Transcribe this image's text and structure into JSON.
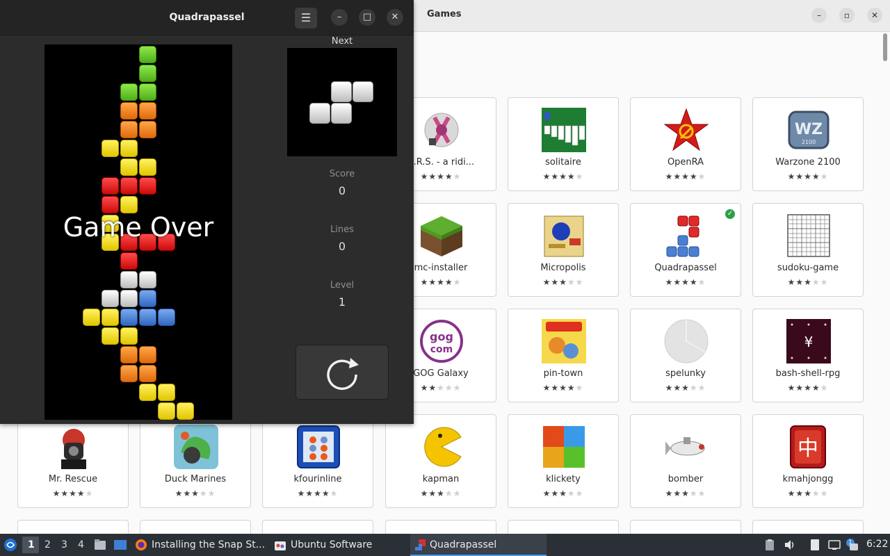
{
  "games_window": {
    "title": "Games",
    "controls": {
      "minimize": "–",
      "maximize": "▫",
      "close": "✕"
    },
    "tiles": [
      {
        "name": "A.R.S. - a ridi...",
        "rating": 4,
        "icon": "ars-icon",
        "installed": false
      },
      {
        "name": "solitaire",
        "rating": 4,
        "icon": "solitaire-icon",
        "installed": false
      },
      {
        "name": "OpenRA",
        "rating": 4,
        "icon": "openra-icon",
        "installed": false
      },
      {
        "name": "Warzone 2100",
        "rating": 4,
        "icon": "warzone-icon",
        "installed": false
      },
      {
        "name": "mc-installer",
        "rating": 4,
        "icon": "grass-block-icon",
        "installed": false
      },
      {
        "name": "Micropolis",
        "rating": 3,
        "icon": "micropolis-icon",
        "installed": false
      },
      {
        "name": "Quadrapassel",
        "rating": 4,
        "icon": "quadrapassel-icon",
        "installed": true
      },
      {
        "name": "sudoku-game",
        "rating": 3,
        "icon": "sudoku-icon",
        "installed": false
      },
      {
        "name": "GOG Galaxy",
        "rating": 2,
        "icon": "gog-icon",
        "installed": false
      },
      {
        "name": "pin-town",
        "rating": 4,
        "icon": "pin-town-icon",
        "installed": false
      },
      {
        "name": "spelunky",
        "rating": 3,
        "icon": "spelunky-icon",
        "installed": false
      },
      {
        "name": "bash-shell-rpg",
        "rating": 4,
        "icon": "bash-rpg-icon",
        "installed": false
      },
      {
        "name": "Mr. Rescue",
        "rating": 4,
        "icon": "mr-rescue-icon",
        "installed": false
      },
      {
        "name": "Duck Marines",
        "rating": 3,
        "icon": "duck-marines-icon",
        "installed": false
      },
      {
        "name": "kfourinline",
        "rating": 4,
        "icon": "kfourinline-icon",
        "installed": false
      },
      {
        "name": "kapman",
        "rating": 3,
        "icon": "kapman-icon",
        "installed": false
      },
      {
        "name": "klickety",
        "rating": 3,
        "icon": "klickety-icon",
        "installed": false
      },
      {
        "name": "bomber",
        "rating": 3,
        "icon": "bomber-icon",
        "installed": false
      },
      {
        "name": "kmahjongg",
        "rating": 3,
        "icon": "kmahjongg-icon",
        "installed": false
      }
    ]
  },
  "quadrapassel": {
    "title": "Quadrapassel",
    "menu_icon": "☰",
    "minimize": "–",
    "maximize": "□",
    "close": "✕",
    "game_over": "Game Over",
    "next_label": "Next",
    "score_label": "Score",
    "score": "0",
    "lines_label": "Lines",
    "lines": "0",
    "level_label": "Level",
    "level": "1"
  },
  "taskbar": {
    "workspaces": [
      "1",
      "2",
      "3",
      "4"
    ],
    "tasks": [
      {
        "label": "Installing the Snap St...",
        "icon": "firefox-icon"
      },
      {
        "label": "Ubuntu Software",
        "icon": "software-icon"
      },
      {
        "label": "Quadrapassel",
        "icon": "quadrapassel-icon"
      }
    ],
    "clock": "6:22",
    "notification_count": "1"
  }
}
